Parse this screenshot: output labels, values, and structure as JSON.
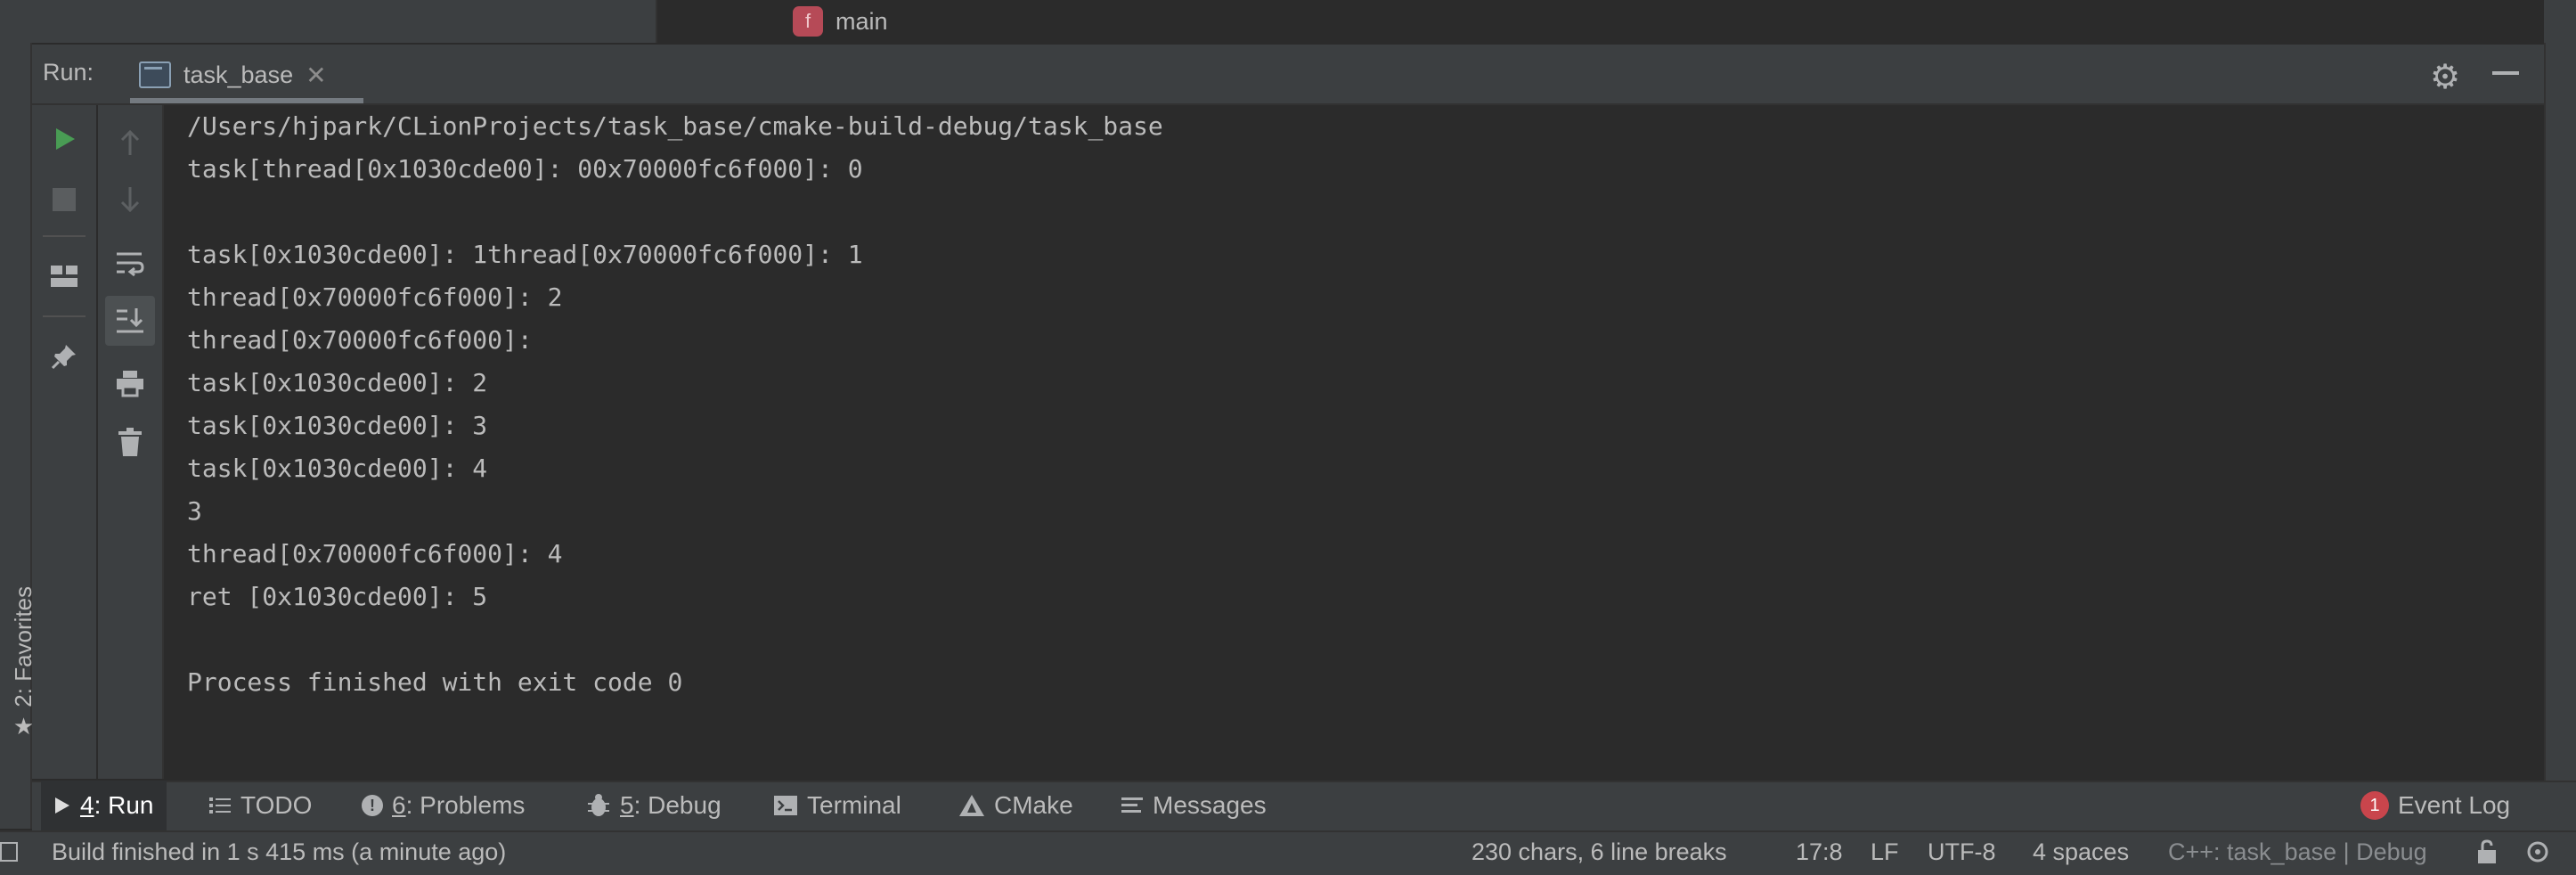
{
  "editor_tab": {
    "icon_letter": "f",
    "label": "main"
  },
  "favorites": {
    "label": "2: Favorites"
  },
  "run_panel": {
    "title": "Run:",
    "tab_label": "task_base",
    "close_glyph": "✕"
  },
  "console": {
    "lines": [
      "/Users/hjpark/CLionProjects/task_base/cmake-build-debug/task_base",
      "task[thread[0x1030cde00]: 00x70000fc6f000]: 0",
      "",
      "task[0x1030cde00]: 1thread[0x70000fc6f000]: 1",
      "thread[0x70000fc6f000]: 2",
      "thread[0x70000fc6f000]:",
      "task[0x1030cde00]: 2",
      "task[0x1030cde00]: 3",
      "task[0x1030cde00]: 4",
      "3",
      "thread[0x70000fc6f000]: 4",
      "ret [0x1030cde00]: 5",
      "",
      "Process finished with exit code 0"
    ]
  },
  "bottom_tools": {
    "run": {
      "mnemonic": "4",
      "label": ": Run"
    },
    "todo": {
      "label": "TODO"
    },
    "problems": {
      "mnemonic": "6",
      "label": ": Problems"
    },
    "debug": {
      "mnemonic": "5",
      "label": ": Debug"
    },
    "terminal": {
      "label": "Terminal"
    },
    "cmake": {
      "label": "CMake"
    },
    "messages": {
      "label": "Messages"
    },
    "event_log": {
      "badge": "1",
      "label": "Event Log"
    }
  },
  "status_bar": {
    "message": "Build finished in 1 s 415 ms (a minute ago)",
    "chars": "230 chars, 6 line breaks",
    "position": "17:8",
    "line_sep": "LF",
    "encoding": "UTF-8",
    "indent": "4 spaces",
    "context": "C++: task_base | Debug"
  },
  "colors": {
    "run_green": "#499c54",
    "panel_bg": "#3c3f41",
    "console_bg": "#2b2b2b",
    "text": "#bbbbbb",
    "badge_red": "#c9454c"
  }
}
